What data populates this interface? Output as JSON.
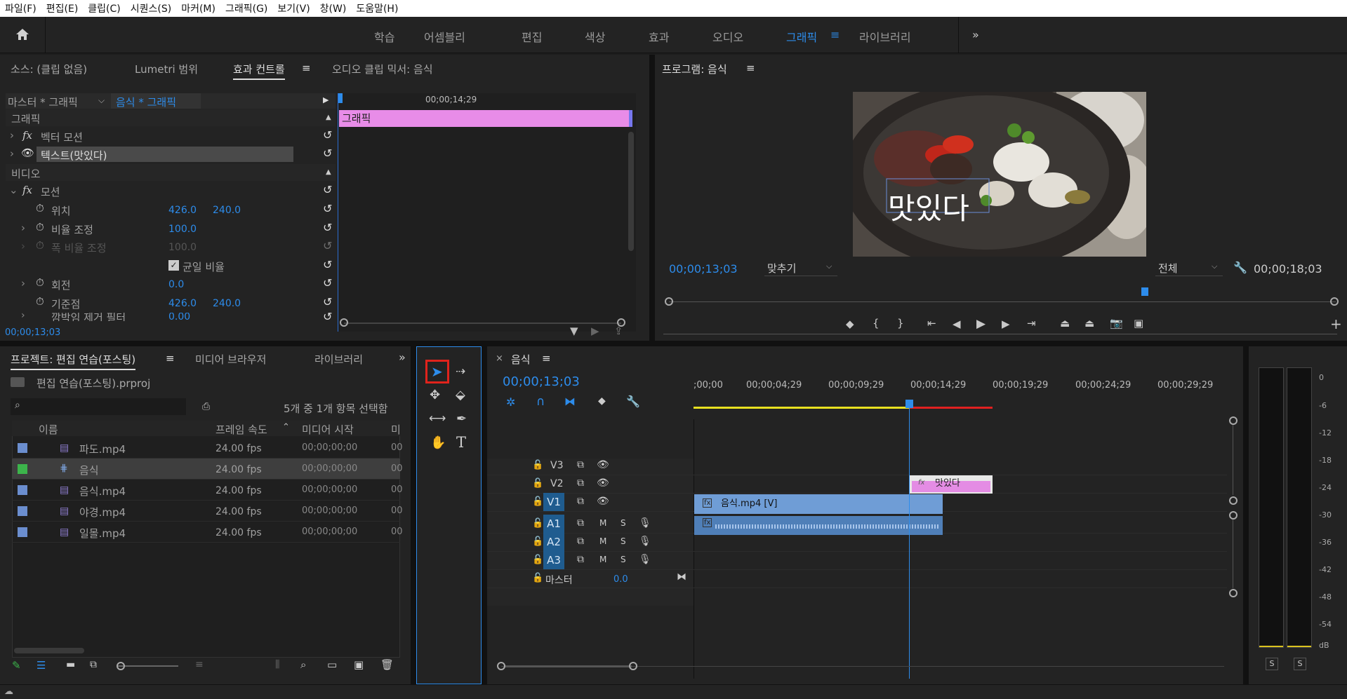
{
  "menu": [
    "파일(F)",
    "편집(E)",
    "클립(C)",
    "시퀀스(S)",
    "마커(M)",
    "그래픽(G)",
    "보기(V)",
    "창(W)",
    "도움말(H)"
  ],
  "workspaces": [
    "학습",
    "어셈블리",
    "편집",
    "색상",
    "효과",
    "오디오",
    "그래픽",
    "라이브러리"
  ],
  "active_workspace": "그래픽",
  "source_tabs": [
    "소스: (클립 없음)",
    "Lumetri 범위",
    "효과 컨트롤",
    "오디오 클립 믹서: 음식"
  ],
  "ec": {
    "master": "마스터 * 그래픽",
    "clip": "음식 * 그래픽",
    "time_ruler": "00;00;14;29",
    "bar_label": "그래픽",
    "sec_graphic": "그래픽",
    "vector_motion": "벡터 모션",
    "text_layer": "텍스트(맛있다)",
    "sec_video": "비디오",
    "motion": "모션",
    "position": "위치",
    "pos_x": "426.0",
    "pos_y": "240.0",
    "scale": "비율 조정",
    "scale_val": "100.0",
    "scale_w": "폭 비율 조정",
    "scale_w_val": "100.0",
    "uniform": "균일 비율",
    "rotation": "회전",
    "rot_val": "0.0",
    "anchor": "기준점",
    "anc_x": "426.0",
    "anc_y": "240.0",
    "flicker": "깜박임 제거 필터",
    "flicker_val": "0.00",
    "timecode": "00;00;13;03"
  },
  "program": {
    "title": "프로그램: 음식",
    "overlay_text": "맛있다",
    "timecode": "00;00;13;03",
    "fit": "맞추기",
    "quality": "전체",
    "duration": "00;00;18;03"
  },
  "project": {
    "tabs": [
      "프로젝트: 편집 연습(포스팅)",
      "미디어 브라우저",
      "라이브러리"
    ],
    "file": "편집 연습(포스팅).prproj",
    "selection": "5개 중 1개 항목 선택함",
    "cols": [
      "이름",
      "프레임 속도",
      "미디어 시작",
      "미"
    ],
    "rows": [
      {
        "name": "파도.mp4",
        "fps": "24.00 fps",
        "start": "00;00;00;00",
        "extra": "00",
        "color": "#6b8ecf"
      },
      {
        "name": "음식",
        "fps": "24.00 fps",
        "start": "00;00;00;00",
        "extra": "00",
        "color": "#3cb44b"
      },
      {
        "name": "음식.mp4",
        "fps": "24.00 fps",
        "start": "00;00;00;00",
        "extra": "00",
        "color": "#6b8ecf"
      },
      {
        "name": "야경.mp4",
        "fps": "24.00 fps",
        "start": "00;00;00;00",
        "extra": "00",
        "color": "#6b8ecf"
      },
      {
        "name": "일몰.mp4",
        "fps": "24.00 fps",
        "start": "00;00;00;00",
        "extra": "00",
        "color": "#6b8ecf"
      }
    ]
  },
  "timeline": {
    "tab": "음식",
    "timecode": "00;00;13;03",
    "ruler": [
      ";00;00",
      "00;00;04;29",
      "00;00;09;29",
      "00;00;14;29",
      "00;00;19;29",
      "00;00;24;29",
      "00;00;29;29"
    ],
    "tracks": {
      "v3": "V3",
      "v2": "V2",
      "v1": "V1",
      "a1": "A1",
      "a2": "A2",
      "a3": "A3",
      "m": "M",
      "s": "S"
    },
    "master": "마스터",
    "master_val": "0.0",
    "clip_v2": "맛있다",
    "clip_v1": "음식.mp4 [V]"
  },
  "meter": {
    "scale": [
      "0",
      "-6",
      "-12",
      "-18",
      "-24",
      "-30",
      "-36",
      "-42",
      "-48",
      "-54",
      "dB"
    ],
    "solo": "S"
  }
}
